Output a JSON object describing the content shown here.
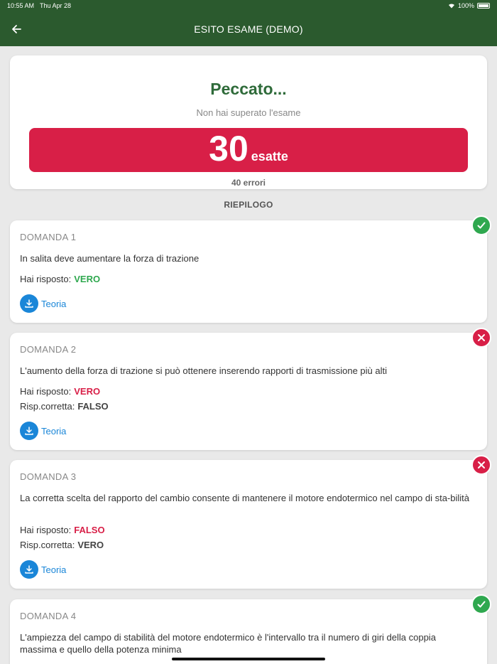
{
  "status": {
    "time": "10:55 AM",
    "date": "Thu Apr 28",
    "battery": "100%"
  },
  "appbar": {
    "title": "ESITO ESAME (DEMO)",
    "back_icon": "arrow-left-icon"
  },
  "result": {
    "headline": "Peccato...",
    "subtitle": "Non hai superato l'esame",
    "correct_count": "30",
    "correct_label": "esatte",
    "errors": "40 errori",
    "bar_color": "#d81f47"
  },
  "summary_title": "RIEPILOGO",
  "questions": [
    {
      "number": "DOMANDA 1",
      "text": "In salita deve aumentare la forza di trazione",
      "answered_label": "Hai risposto:",
      "answered_value": "VERO",
      "correct_label": "",
      "correct_value": "",
      "result": "correct",
      "theory_label": "Teoria"
    },
    {
      "number": "DOMANDA 2",
      "text": "L'aumento della forza di trazione si può ottenere inserendo rapporti di trasmissione più alti",
      "answered_label": "Hai risposto:",
      "answered_value": "VERO",
      "correct_label": "Risp.corretta:",
      "correct_value": "FALSO",
      "result": "wrong",
      "theory_label": "Teoria"
    },
    {
      "number": "DOMANDA 3",
      "text": "La corretta scelta del rapporto del cambio consente di mantenere il motore endotermico nel campo di sta-bilità",
      "answered_label": "Hai risposto:",
      "answered_value": "FALSO",
      "correct_label": "Risp.corretta:",
      "correct_value": "VERO",
      "result": "wrong",
      "theory_label": "Teoria"
    },
    {
      "number": "DOMANDA 4",
      "text": "L'ampiezza del campo di stabilità del motore endotermico è l'intervallo tra il numero di giri della coppia massima e quello della potenza minima",
      "result": "correct"
    }
  ],
  "colors": {
    "header": "#2b5a2e",
    "correct": "#2fa84f",
    "wrong": "#d81f47",
    "link": "#1a86d8"
  }
}
